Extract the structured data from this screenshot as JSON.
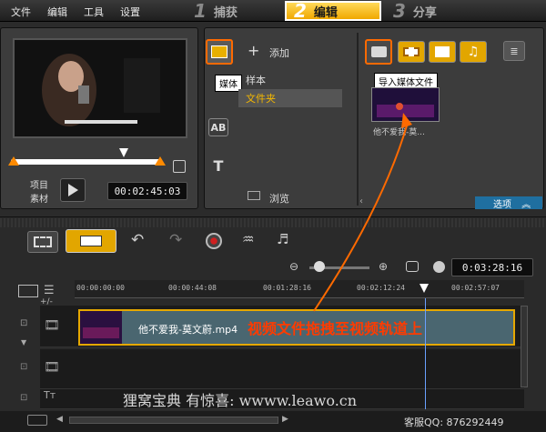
{
  "menu": {
    "file": "文件",
    "edit": "编辑",
    "tools": "工具",
    "settings": "设置"
  },
  "steps": [
    {
      "num": "1",
      "label": "捕获"
    },
    {
      "num": "2",
      "label": "编辑"
    },
    {
      "num": "3",
      "label": "分享"
    }
  ],
  "preview": {
    "mode_project": "项目",
    "mode_clip": "素材",
    "timecode": "00:02:45:03"
  },
  "library": {
    "add_label": "添加",
    "media_tooltip": "媒体",
    "tree_sample": "样本",
    "tree_folder": "文件夹",
    "browse_label": "浏览",
    "import_tooltip": "导入媒体文件",
    "thumb_caption": "他不爱我-莫...",
    "options_label": "选项"
  },
  "timeline": {
    "timecode": "0:03:28:16",
    "ruler": [
      "00:00:00:00",
      "00:00:44:08",
      "00:01:28:16",
      "00:02:12:24",
      "00:02:57:07"
    ],
    "clip_name": "他不爱我-莫文蔚.mp4",
    "annotation": "视频文件拖拽至视频轨道上",
    "add_track_label": "+/-"
  },
  "watermark": {
    "text": "狸窝宝典  有惊喜: wwww.leawo.cn",
    "qq": "客服QQ: 876292449"
  },
  "colors": {
    "accent": "#ff6a00",
    "step_active": "#f5b800"
  }
}
